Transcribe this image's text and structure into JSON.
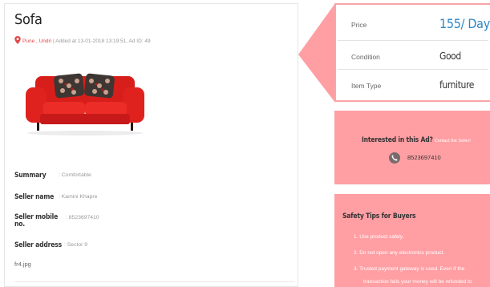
{
  "listing": {
    "title": "Sofa",
    "location": "Pune , Undri",
    "meta_text": "| Added at 13-01-2018 13:19:51, Ad ID: 49",
    "details": [
      {
        "label": "Summary",
        "value": ": Comfortable"
      },
      {
        "label": "Seller name",
        "value": ": Kamini Khapre"
      },
      {
        "label": "Seller mobile no.",
        "value": ": 8523697410"
      },
      {
        "label": "Seller address",
        "value": ": Sector 9"
      }
    ],
    "file_name": "fr4.jpg"
  },
  "price_card": {
    "rows": [
      {
        "label": "Price",
        "value": "155/ Day"
      },
      {
        "label": "Condition",
        "value": "Good"
      },
      {
        "label": "Item Type",
        "value": "furniture"
      }
    ]
  },
  "interest": {
    "heading": "Interested in this Ad?",
    "subtext": "Contact the Seller!",
    "phone": "8523697410"
  },
  "safety": {
    "heading": "Safety Tips for Buyers",
    "tips": [
      "1. Use product safely.",
      "2. Do not open any electronics product.",
      "3. Trusted payment gateway is used. Even if the",
      "transaction fails your money will be refunded to"
    ]
  },
  "colors": {
    "accent_pink": "#ff9fa3",
    "price_blue": "#2b86c5",
    "location_red": "#e04848"
  },
  "icons": [
    "location-pin-icon",
    "phone-icon"
  ]
}
